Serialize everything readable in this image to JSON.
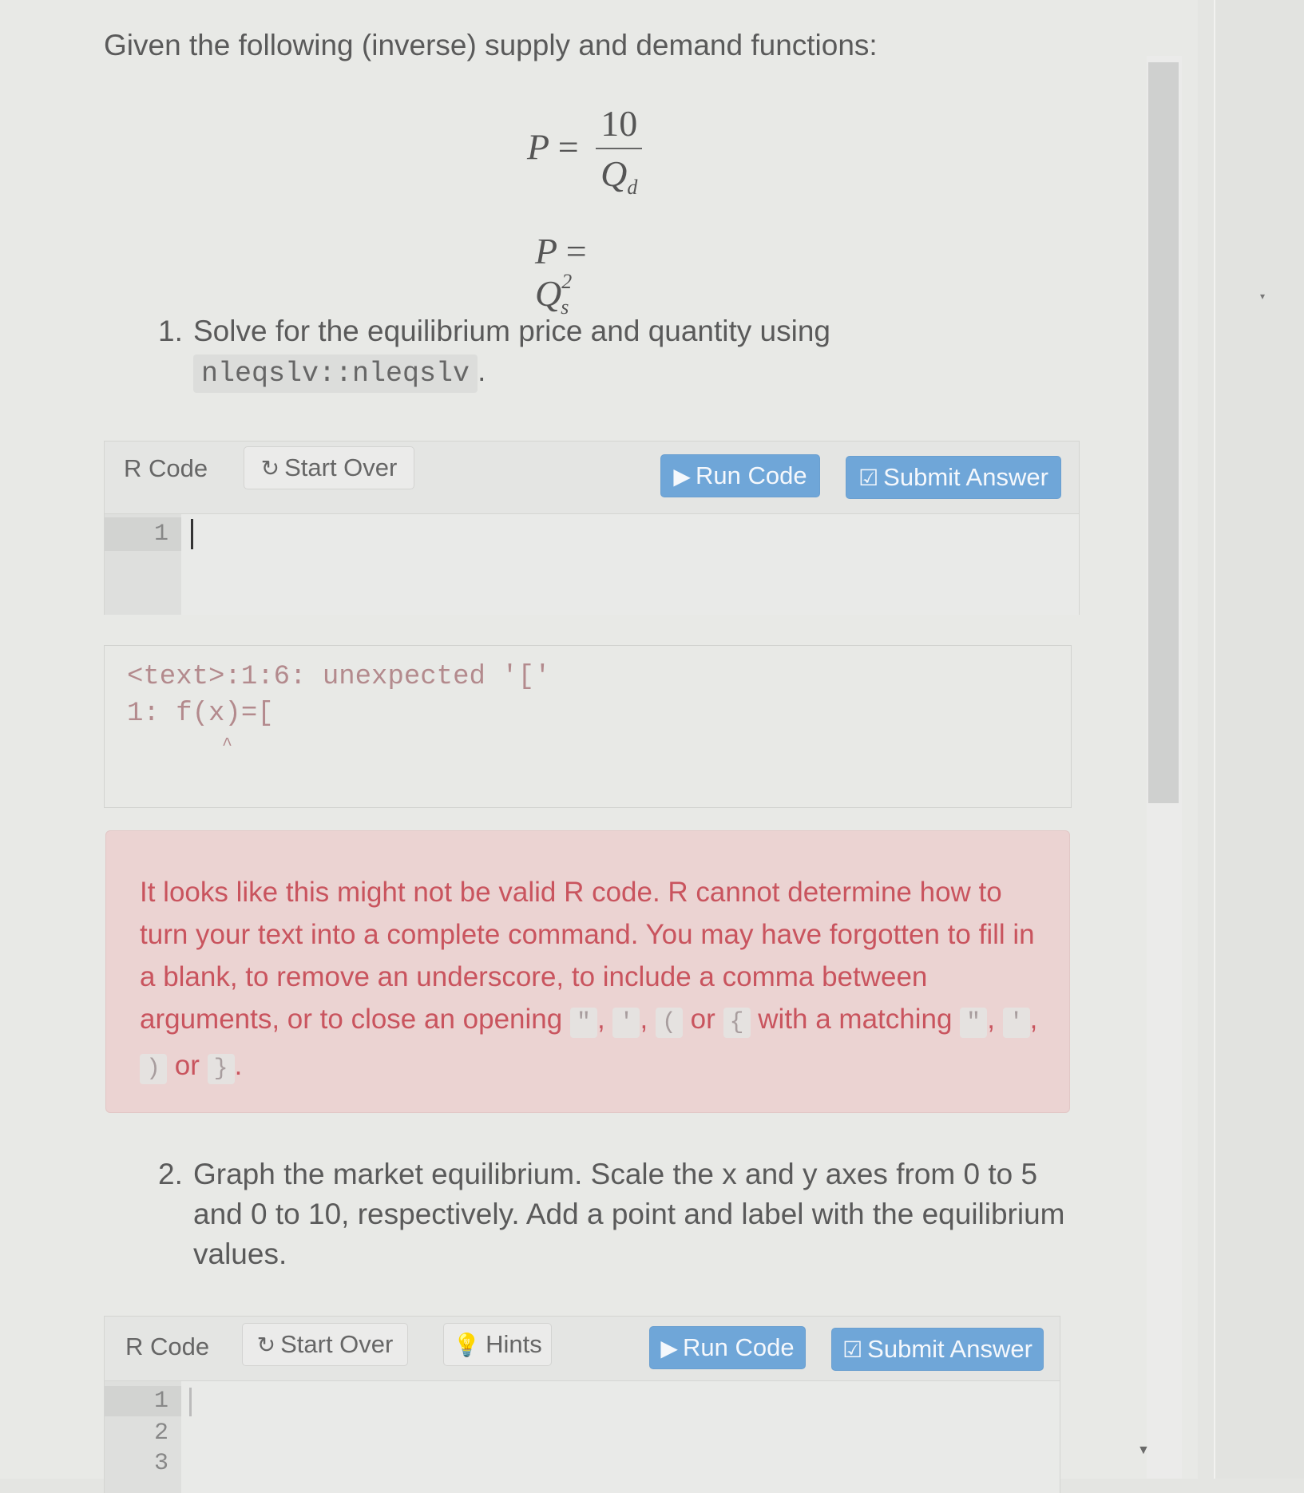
{
  "intro": "Given the following (inverse) supply and demand functions:",
  "equations": {
    "demand": {
      "lhs": "P",
      "eq": "=",
      "numerator": "10",
      "denominator": "Q",
      "denominator_sub": "d"
    },
    "supply": {
      "lhs": "P",
      "eq": "=",
      "rhs": "Q",
      "rhs_sub": "s",
      "rhs_sup": "2"
    }
  },
  "questions": [
    {
      "number": "1.",
      "text": "Solve for the equilibrium price and quantity using",
      "code": "nleqslv::nleqslv",
      "suffix": "."
    },
    {
      "number": "2.",
      "text": "Graph the market equilibrium. Scale the x and y axes from 0 to 5 and 0 to 10, respectively. Add a point and label with the equilibrium values."
    }
  ],
  "exercise1": {
    "label": "R Code",
    "start_over": "Start Over",
    "run_code": "Run Code",
    "submit": "Submit Answer",
    "line_numbers": [
      "1"
    ],
    "code": ""
  },
  "output1": {
    "line1": "<text>:1:6: unexpected '['",
    "line2": "1: f(x)=[",
    "line3": "         ^"
  },
  "alert": {
    "text1": "It looks like this might not be valid R code. R cannot determine how to turn your text into a complete command. You may have forgotten to fill in a blank, to remove an underscore, to include a comma between arguments, or to close an opening",
    "open_tokens": [
      "\"",
      "'",
      "("
    ],
    "or1": "or",
    "brace_open": "{",
    "with_matching": "with a matching",
    "close_tokens": [
      "\"",
      "'",
      ")"
    ],
    "or2": "or",
    "brace_close": "}",
    "end": "."
  },
  "exercise2": {
    "label": "R Code",
    "start_over": "Start Over",
    "hints": "Hints",
    "run_code": "Run Code",
    "submit": "Submit Answer",
    "line_numbers": [
      "1",
      "2",
      "3"
    ],
    "code": ""
  },
  "colors": {
    "primary_button": "#6fa6d8",
    "alert_bg": "#ebd3d2",
    "alert_text": "#c9545e"
  }
}
